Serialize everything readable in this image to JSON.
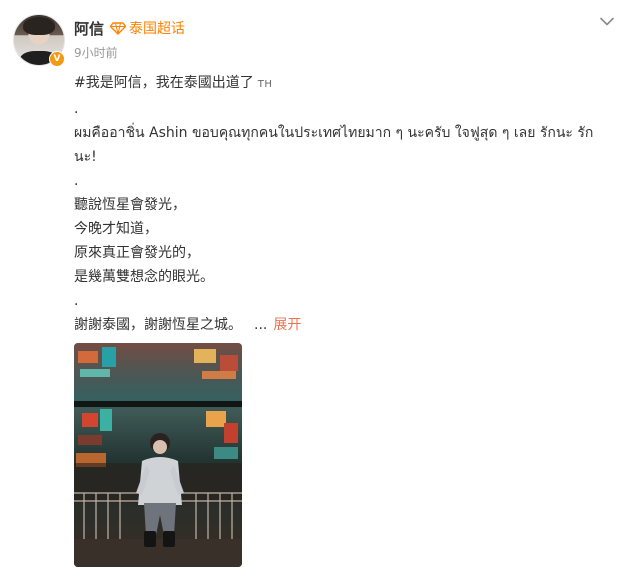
{
  "post": {
    "author": "阿信",
    "tag": "泰国超话",
    "verified_badge": "V",
    "time": "9小时前",
    "lines": [
      "#我是阿信，我在泰國出道了",
      ".",
      "ผมคืออาชิ่น Ashin ขอบคุณทุกคนในประเทศไทยมาก ๆ นะครับ ใจฟูสุด ๆ เลย รักนะ รัก",
      "นะ!",
      ".",
      "聽說恆星會發光，",
      "今晚才知道，",
      "原來真正會發光的，",
      "是幾萬雙想念的眼光。",
      ".",
      "謝謝泰國，謝謝恆星之城。"
    ],
    "flag_label": "TH",
    "ellipsis": "...",
    "expand_label": "展开"
  },
  "icons": {
    "tag": "diamond-tag-icon",
    "more": "chevron-down-icon"
  },
  "colors": {
    "accent": "#ff8200",
    "expand": "#eb7350",
    "meta": "#999999",
    "text": "#333333"
  }
}
